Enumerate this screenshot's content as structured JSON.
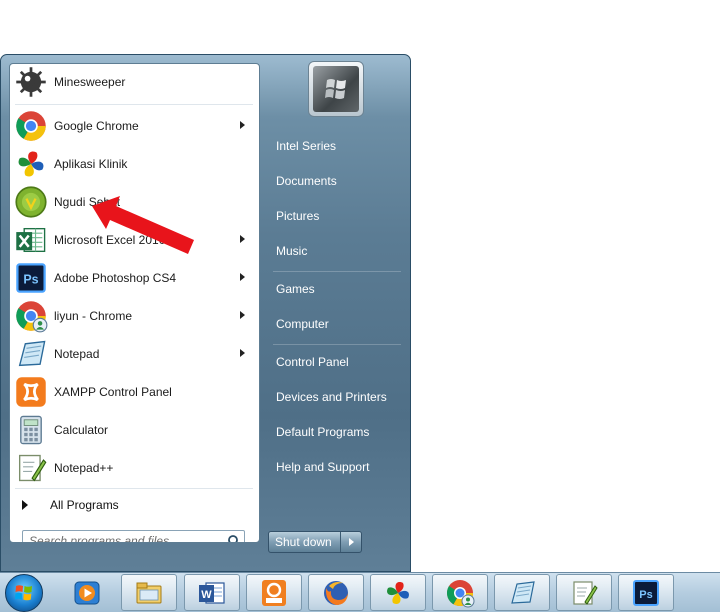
{
  "start_menu": {
    "pinned": {
      "label": "Minesweeper",
      "icon": "minesweeper-icon"
    },
    "programs": [
      {
        "label": "Google Chrome",
        "icon": "chrome-icon",
        "submenu": true
      },
      {
        "label": "Aplikasi Klinik",
        "icon": "pinwheel-icon",
        "submenu": false
      },
      {
        "label": "Ngudi Sehat",
        "icon": "ngudi-sehat-icon",
        "submenu": false
      },
      {
        "label": "Microsoft Excel 2010",
        "icon": "excel-icon",
        "submenu": true
      },
      {
        "label": "Adobe Photoshop CS4",
        "icon": "photoshop-icon",
        "submenu": true
      },
      {
        "label": "liyun - Chrome",
        "icon": "chrome-user-icon",
        "submenu": true
      },
      {
        "label": "Notepad",
        "icon": "notepad-icon",
        "submenu": true
      },
      {
        "label": "XAMPP Control Panel",
        "icon": "xampp-icon",
        "submenu": false
      },
      {
        "label": "Calculator",
        "icon": "calculator-icon",
        "submenu": false
      },
      {
        "label": "Notepad++",
        "icon": "notepadpp-icon",
        "submenu": false
      }
    ],
    "all_programs_label": "All Programs",
    "search_placeholder": "Search programs and files",
    "right_links": [
      "Intel Series",
      "Documents",
      "Pictures",
      "Music",
      "Games",
      "Computer",
      "Control Panel",
      "Devices and Printers",
      "Default Programs",
      "Help and Support"
    ],
    "shutdown_label": "Shut down"
  },
  "annotation": {
    "arrow_color": "#e8141b",
    "points_to": "Ngudi Sehat"
  },
  "taskbar": {
    "items": [
      "media-player-icon",
      "explorer-icon",
      "word-icon",
      "foxit-pdf-icon",
      "firefox-icon",
      "pinwheel-icon",
      "chrome-user-icon",
      "notepad-icon",
      "notepadpp-icon",
      "photoshop-icon"
    ]
  }
}
